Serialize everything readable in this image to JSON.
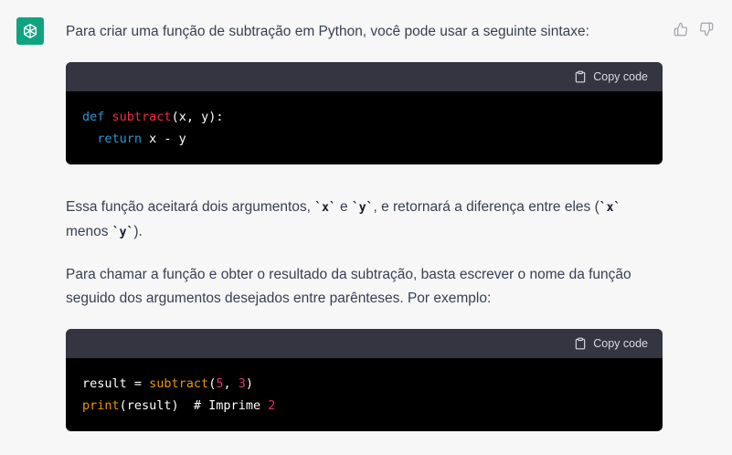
{
  "assistant_avatar": {
    "icon": "openai-logo-icon",
    "color": "#10a37f"
  },
  "feedback": {
    "thumbs_up_icon": "thumbs-up-icon",
    "thumbs_down_icon": "thumbs-down-icon"
  },
  "message": {
    "intro": "Para criar uma função de subtração em Python, você pode usar a seguinte sintaxe:",
    "code1": {
      "copy_label": "Copy code",
      "line1": {
        "kw": "def",
        "sp": " ",
        "fn": "subtract",
        "rest": "(x, y):"
      },
      "line2": {
        "indent": "  ",
        "kw": "return",
        "rest": " x - y"
      }
    },
    "p2": {
      "t1": "Essa função aceitará dois argumentos, ",
      "c1": "`x`",
      "t2": " e ",
      "c2": "`y`",
      "t3": ", e retornará a diferença entre eles (",
      "c3": "`x`",
      "t4": " menos ",
      "c4": "`y`",
      "t5": ")."
    },
    "p3": "Para chamar a função e obter o resultado da subtração, basta escrever o nome da função seguido dos argumentos desejados entre parênteses. Por exemplo:",
    "code2": {
      "copy_label": "Copy code",
      "line1": {
        "a": "result = ",
        "fn": "subtract",
        "b": "(",
        "n1": "5",
        "c": ", ",
        "n2": "3",
        "d": ")"
      },
      "line2": {
        "bi": "print",
        "a": "(result)  ",
        "cm": "# Imprime ",
        "n": "2"
      }
    }
  }
}
